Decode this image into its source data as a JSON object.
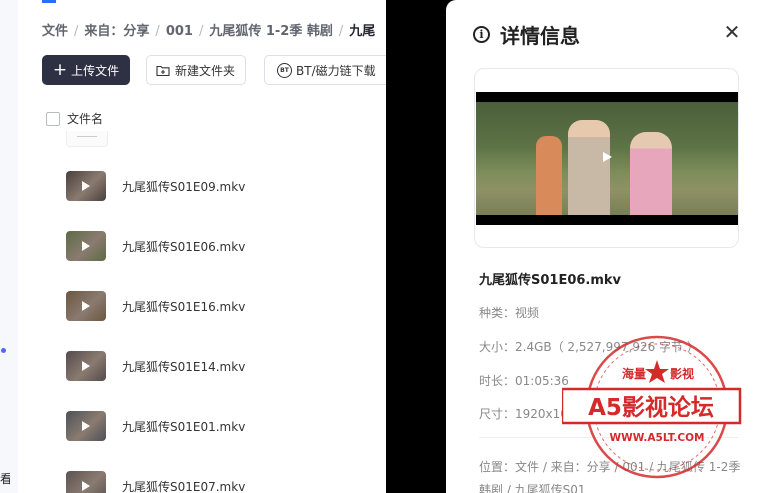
{
  "breadcrumb": {
    "items": [
      "文件",
      "来自：分享",
      "001",
      "九尾狐传 1-2季 韩剧"
    ],
    "current": "九尾"
  },
  "toolbar": {
    "upload_label": "上传文件",
    "new_folder_label": "新建文件夹",
    "bt_label": "BT/磁力链下载",
    "bt_badge": "BT"
  },
  "list": {
    "header_label": "文件名",
    "files": [
      {
        "name": "九尾狐传S01E09.mkv",
        "thumb": "#4a3f3d"
      },
      {
        "name": "九尾狐传S01E06.mkv",
        "thumb": "#5d6b45"
      },
      {
        "name": "九尾狐传S01E16.mkv",
        "thumb": "#6b5640"
      },
      {
        "name": "九尾狐传S01E14.mkv",
        "thumb": "#554a4c"
      },
      {
        "name": "九尾狐传S01E01.mkv",
        "thumb": "#4e5158"
      },
      {
        "name": "九尾狐传S01E07.mkv",
        "thumb": "#5b5252"
      }
    ]
  },
  "left_edge_char": "看",
  "details": {
    "title": "详情信息",
    "file_name": "九尾狐传S01E06.mkv",
    "type": "种类：视频",
    "size": "大小：2.4GB（ 2,527,997,926 字节 ）",
    "duration": "时长：01:05:36",
    "resolution": "尺寸：1920x1080",
    "location": "位置：文件 / 来自：分享 / 001 / 九尾狐传 1-2季 韩剧 / 九尾狐传S01"
  },
  "watermark": {
    "top_text": "海量",
    "top_text_right": "影视",
    "main_text": "A5影视论坛",
    "url": "WWW.A5LT.COM",
    "color": "#d42a2a"
  },
  "colors": {
    "upload_button": "#2e3143",
    "accent": "#2b6cff"
  }
}
